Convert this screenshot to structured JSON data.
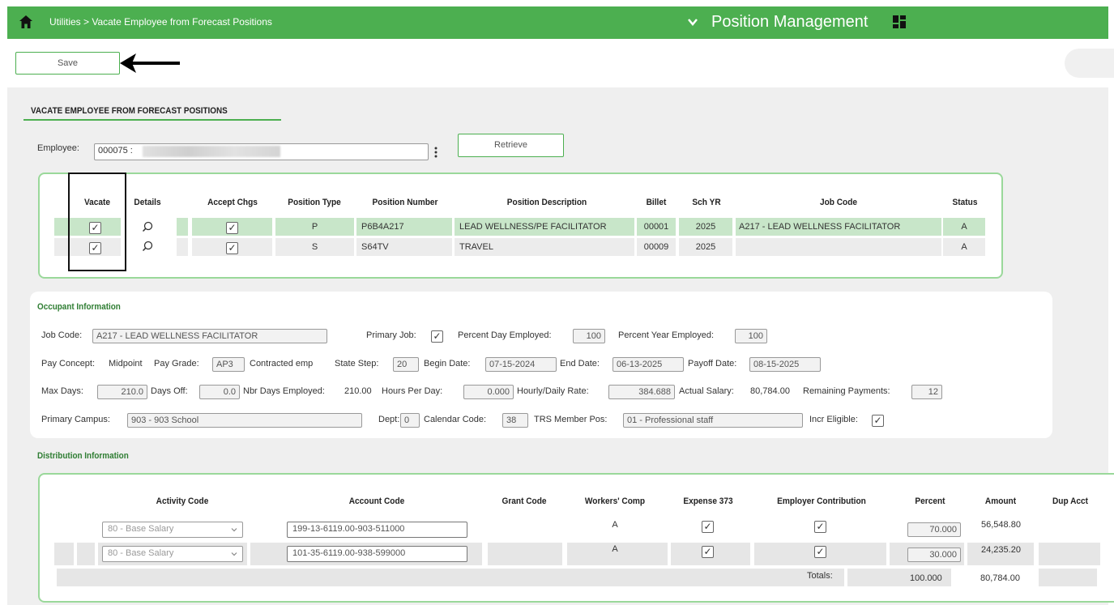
{
  "header": {
    "breadcrumb": "Utilities > Vacate Employee from Forecast Positions",
    "app_title": "Position Management",
    "brand_color": "#4caf50"
  },
  "toolbar": {
    "save_label": "Save"
  },
  "page": {
    "title": "VACATE EMPLOYEE FROM FORECAST POSITIONS"
  },
  "employee": {
    "label": "Employee:",
    "value": "000075 :",
    "retrieve_label": "Retrieve"
  },
  "positions": {
    "headers": [
      "Vacate",
      "Details",
      "Accept Chgs",
      "Position Type",
      "Position Number",
      "Position Description",
      "Billet",
      "Sch YR",
      "Job Code",
      "Status"
    ],
    "rows": [
      {
        "vacate": "✓",
        "accept": "✓",
        "type": "P",
        "number": "P6B4A217",
        "description": "LEAD WELLNESS/PE FACILITATOR",
        "billet": "00001",
        "year": "2025",
        "job_code": "A217 - LEAD WELLNESS FACILITATOR",
        "status": "A"
      },
      {
        "vacate": "✓",
        "accept": "✓",
        "type": "S",
        "number": "S64TV",
        "description": "TRAVEL",
        "billet": "00009",
        "year": "2025",
        "job_code": "",
        "status": "A"
      }
    ]
  },
  "occupant": {
    "section_label": "Occupant Information",
    "job_code_label": "Job Code:",
    "job_code": "A217 - LEAD WELLNESS FACILITATOR",
    "primary_job_label": "Primary Job:",
    "primary_job": "✓",
    "pct_day_label": "Percent Day Employed:",
    "pct_day": "100",
    "pct_year_label": "Percent Year Employed:",
    "pct_year": "100",
    "pay_concept_label": "Pay Concept:",
    "pay_concept": "Midpoint",
    "pay_grade_label": "Pay Grade:",
    "pay_grade": "AP3",
    "contracted_label": "Contracted emp",
    "state_step_label": "State Step:",
    "state_step": "20",
    "begin_label": "Begin Date:",
    "begin": "07-15-2024",
    "end_label": "End Date:",
    "end": "06-13-2025",
    "payoff_label": "Payoff Date:",
    "payoff": "08-15-2025",
    "max_days_label": "Max Days:",
    "max_days": "210.0",
    "days_off_label": "Days Off:",
    "days_off": "0.0",
    "nbr_days_label": "Nbr Days Employed:",
    "nbr_days": "210.00",
    "hours_label": "Hours Per Day:",
    "hours": "0.000",
    "rate_label": "Hourly/Daily Rate:",
    "rate": "384.688",
    "actual_label": "Actual Salary:",
    "actual": "80,784.00",
    "remaining_label": "Remaining Payments:",
    "remaining": "12",
    "campus_label": "Primary Campus:",
    "campus": "903 - 903 School",
    "dept_label": "Dept:",
    "dept": "0",
    "calendar_label": "Calendar Code:",
    "calendar": "38",
    "trs_label": "TRS Member Pos:",
    "trs": "01 - Professional staff",
    "incr_label": "Incr Eligible:",
    "incr": "✓"
  },
  "distribution": {
    "section_label": "Distribution Information",
    "headers": [
      "Activity Code",
      "Account Code",
      "Grant Code",
      "Workers' Comp",
      "Expense 373",
      "Employer Contribution",
      "Percent",
      "Amount",
      "Dup Acct"
    ],
    "rows": [
      {
        "activity": "80 - Base Salary",
        "account": "199-13-6119.00-903-511000",
        "grant": "",
        "workers": "A",
        "expense": "✓",
        "employer": "✓",
        "percent": "70.000",
        "amount": "56,548.80"
      },
      {
        "activity": "80 - Base Salary",
        "account": "101-35-6119.00-938-599000",
        "grant": "",
        "workers": "A",
        "expense": "✓",
        "employer": "✓",
        "percent": "30.000",
        "amount": "24,235.20"
      }
    ],
    "totals_label": "Totals:",
    "total_percent": "100.000",
    "total_amount": "80,784.00"
  }
}
